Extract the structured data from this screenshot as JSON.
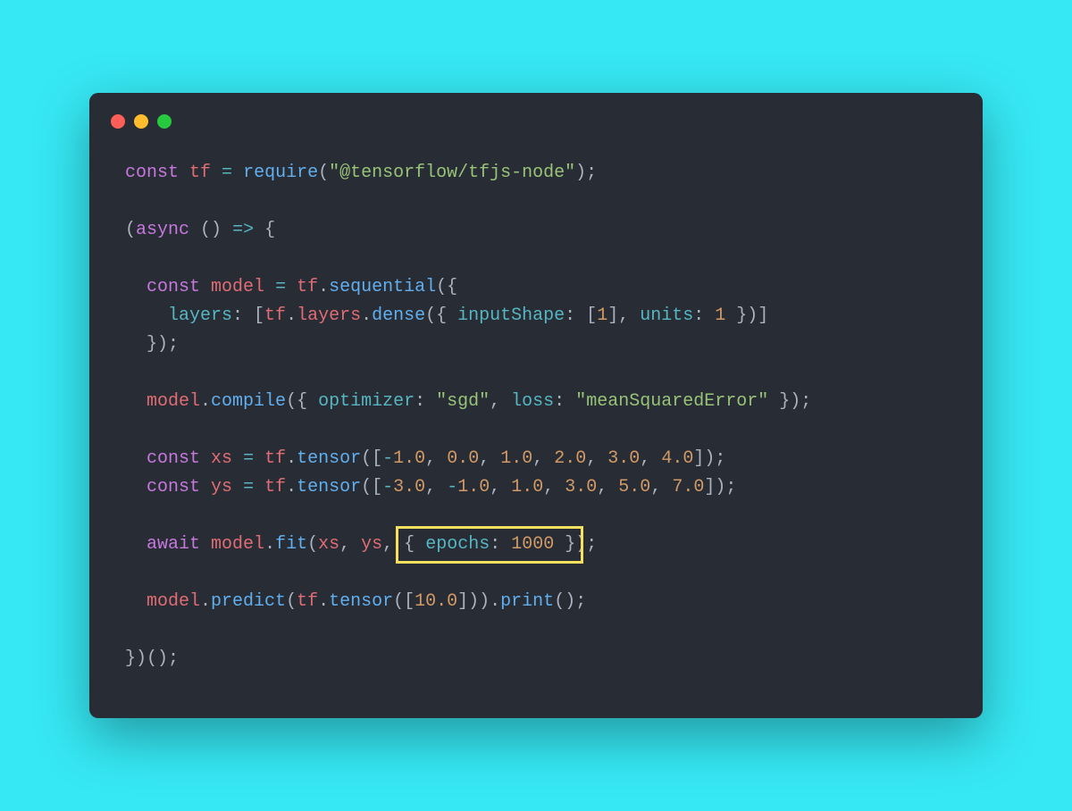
{
  "colors": {
    "page_bg": "#36e8f4",
    "editor_bg": "#282c34",
    "highlight_border": "#f6e05e",
    "dot_red": "#ff5f56",
    "dot_yellow": "#ffbd2e",
    "dot_green": "#27c93f",
    "syntax": {
      "keyword": "#c678dd",
      "variable": "#e06c75",
      "property": "#56b6c2",
      "function": "#61afef",
      "string": "#98c379",
      "number": "#d19a66",
      "punctuation": "#abb2bf",
      "operator": "#56b6c2"
    }
  },
  "tokens": {
    "kw_const": "const",
    "kw_async": "async",
    "kw_await": "await",
    "id_tf": "tf",
    "id_model": "model",
    "id_xs": "xs",
    "id_ys": "ys",
    "fn_require": "require",
    "fn_sequential": "sequential",
    "fn_dense": "dense",
    "fn_compile": "compile",
    "fn_tensor": "tensor",
    "fn_fit": "fit",
    "fn_predict": "predict",
    "fn_print": "print",
    "prop_layers_ns": "layers",
    "prop_layers_key": "layers",
    "prop_inputShape": "inputShape",
    "prop_units": "units",
    "prop_optimizer": "optimizer",
    "prop_loss": "loss",
    "prop_epochs": "epochs",
    "str_pkg": "\"@tensorflow/tfjs-node\"",
    "str_sgd": "\"sgd\"",
    "str_mse": "\"meanSquaredError\"",
    "num_1a": "1",
    "num_1b": "1",
    "num_1000": "1000",
    "arr_xs": {
      "n0": "1.0",
      "n1": "0.0",
      "n2": "1.0",
      "n3": "2.0",
      "n4": "3.0",
      "n5": "4.0"
    },
    "arr_ys": {
      "n0": "3.0",
      "n1": "1.0",
      "n2": "1.0",
      "n3": "3.0",
      "n4": "5.0",
      "n5": "7.0"
    },
    "num_10": "10.0",
    "eq": " = ",
    "arrow": " => ",
    "neg": "-"
  }
}
